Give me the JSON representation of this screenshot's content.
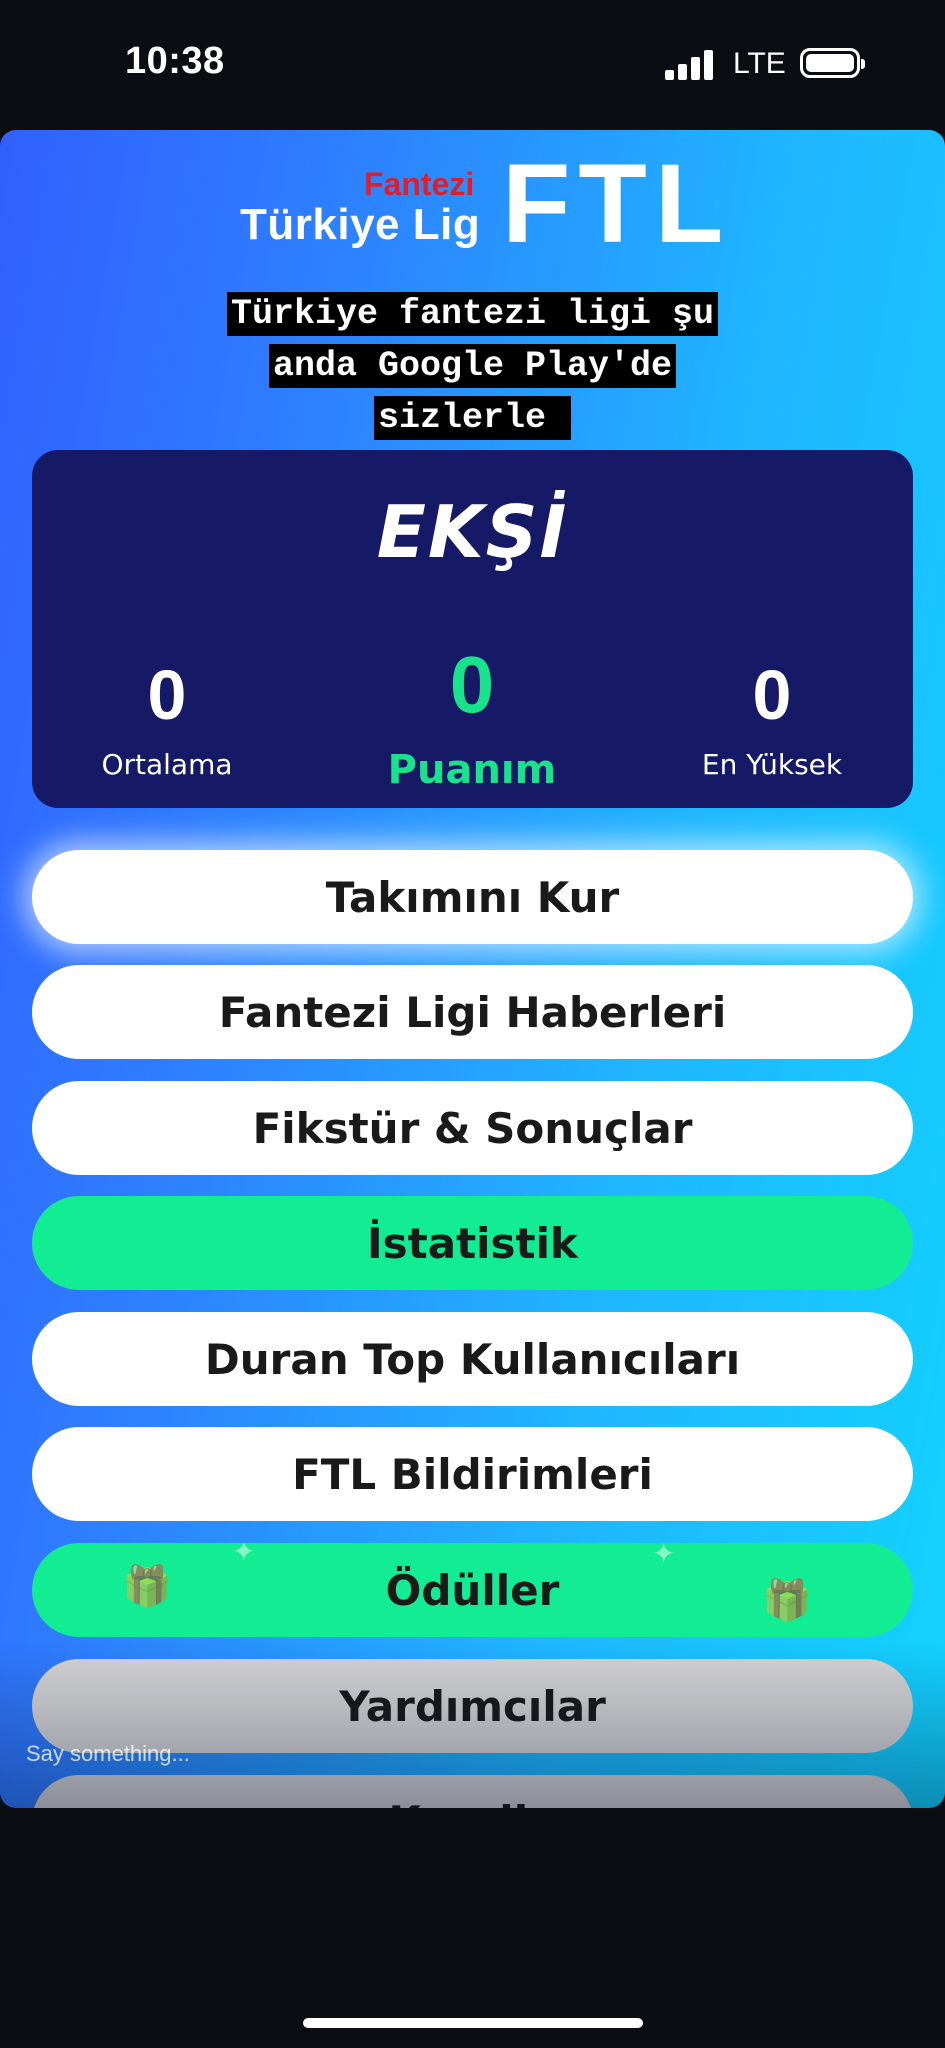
{
  "status_bar": {
    "time": "10:38",
    "network": "LTE",
    "signal_icon": "signal-bars-icon",
    "battery_icon": "battery-icon"
  },
  "logo": {
    "fantezi": "Fantezi",
    "turkiye_lig": "Türkiye Lig",
    "ftl": "FTL"
  },
  "announcement": {
    "lines": [
      "Türkiye fantezi ligi şu",
      "anda Google Play'de",
      "sizlerle "
    ]
  },
  "score_panel": {
    "team_name": "EKŞİ",
    "average_value": "0",
    "average_label": "Ortalama",
    "my_points_value": "0",
    "my_points_label": "Puanım",
    "highest_value": "0",
    "highest_label": "En Yüksek"
  },
  "menu": {
    "items": [
      {
        "label": "Takımını Kur"
      },
      {
        "label": "Fantezi Ligi Haberleri"
      },
      {
        "label": "Fikstür & Sonuçlar"
      },
      {
        "label": "İstatistik"
      },
      {
        "label": "Duran Top Kullanıcıları"
      },
      {
        "label": "FTL Bildirimleri"
      },
      {
        "label": "Ödüller"
      },
      {
        "label": "Yardımcılar"
      },
      {
        "label": "Kuralla"
      }
    ]
  },
  "comment": {
    "placeholder": "Say something..."
  },
  "colors": {
    "accent_green": "#12ec92",
    "panel_navy": "#161a66",
    "logo_red": "#e01e2a"
  }
}
